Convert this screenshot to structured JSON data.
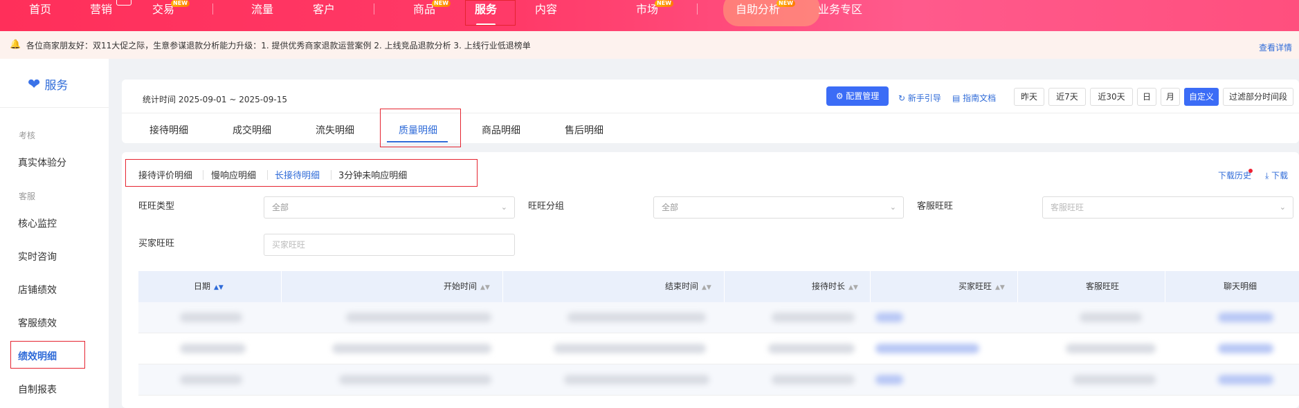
{
  "nav": {
    "items": [
      {
        "label": "首页"
      },
      {
        "label": "营销"
      },
      {
        "label": "交易",
        "tag": "NEW"
      },
      {
        "label": "流量"
      },
      {
        "label": "客户"
      },
      {
        "label": "商品",
        "tag": "NEW"
      },
      {
        "label": "服务",
        "active": true
      },
      {
        "label": "内容"
      },
      {
        "label": "市场",
        "tag": "NEW"
      },
      {
        "label": "自助分析",
        "tag": "NEW"
      },
      {
        "label": "业务专区"
      }
    ]
  },
  "notice": {
    "text": "各位商家朋友好：双11大促之际，生意参谋退款分析能力升级：1. 提供优秀商家退款运营案例 2. 上线竞品退款分析 3. 上线行业低退榜单",
    "link": "查看详情"
  },
  "sidebar": {
    "brand": "服务",
    "groups": [
      {
        "label": "考核",
        "items": [
          "真实体验分"
        ]
      },
      {
        "label": "客服",
        "items": [
          "核心监控",
          "实时咨询",
          "店铺绩效",
          "客服绩效",
          "绩效明细",
          "自制报表"
        ]
      }
    ],
    "active": "绩效明细"
  },
  "header": {
    "stat_time": "统计时间 2025-09-01 ~ 2025-09-15",
    "config_button": "配置管理",
    "guide_link": "新手引导",
    "doc_link": "指南文档",
    "date_buttons": [
      "昨天",
      "近7天",
      "近30天",
      "日",
      "月",
      "自定义",
      "过滤部分时间段"
    ],
    "date_active": "自定义",
    "tabs": [
      "接待明细",
      "成交明细",
      "流失明细",
      "质量明细",
      "商品明细",
      "售后明细"
    ],
    "tab_active": "质量明细"
  },
  "main": {
    "subtabs": [
      "接待评价明细",
      "慢响应明细",
      "长接待明细",
      "3分钟未响应明细"
    ],
    "subtab_active": "长接待明细",
    "download_history": "下载历史",
    "download": "下载",
    "filters": {
      "wangwang_type": {
        "label": "旺旺类型",
        "value": "全部"
      },
      "wangwang_group": {
        "label": "旺旺分组",
        "value": "全部"
      },
      "service_wangwang": {
        "label": "客服旺旺",
        "placeholder": "客服旺旺"
      },
      "buyer_wangwang": {
        "label": "买家旺旺",
        "placeholder": "买家旺旺"
      }
    },
    "table": {
      "columns": [
        "日期",
        "开始时间",
        "结束时间",
        "接待时长",
        "买家旺旺",
        "客服旺旺",
        "聊天明细"
      ]
    }
  },
  "colors": {
    "accent": "#2f6bd8",
    "primary_button": "#3b6cf6",
    "nav_gradient_start": "#ff2f5a",
    "annotation_red": "#e5232f"
  },
  "icons": {
    "notice": "bell-icon",
    "brand": "heart-icon",
    "config": "settings-icon",
    "guide": "guide-icon",
    "doc": "doc-icon",
    "download": "download-icon",
    "sort": "sort-icon",
    "select": "chevron-down-icon"
  }
}
